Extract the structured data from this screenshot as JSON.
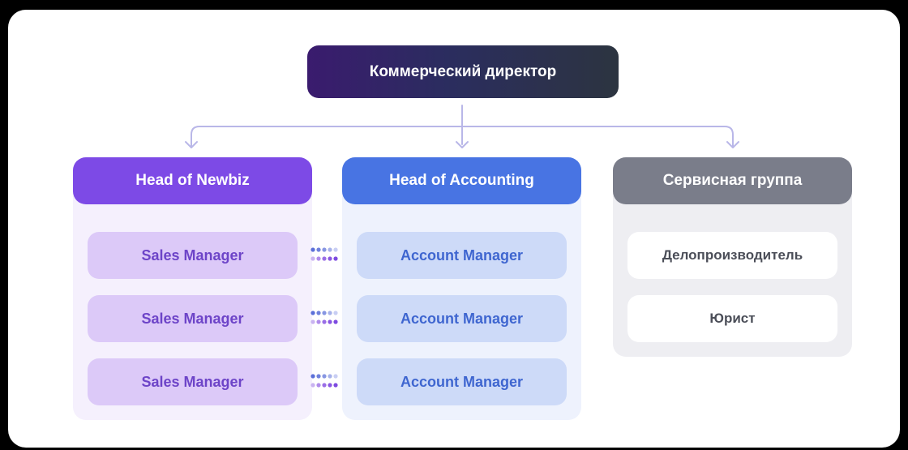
{
  "director": {
    "label": "Коммерческий директор"
  },
  "columns": [
    {
      "head": "Head of Newbiz",
      "items": [
        "Sales Manager",
        "Sales Manager",
        "Sales Manager"
      ]
    },
    {
      "head": "Head of Accounting",
      "items": [
        "Account Manager",
        "Account Manager",
        "Account Manager"
      ]
    },
    {
      "head": "Сервисная группа",
      "items": [
        "Делопроизводитель",
        "Юрист"
      ]
    }
  ],
  "colors": {
    "director_start": "#3a1b6e",
    "director_end": "#2c3440",
    "newbiz_accent": "#7d4ae6",
    "accounting_accent": "#4874e3",
    "service_accent": "#7a7d8a",
    "connector": "#b9b7e8"
  }
}
